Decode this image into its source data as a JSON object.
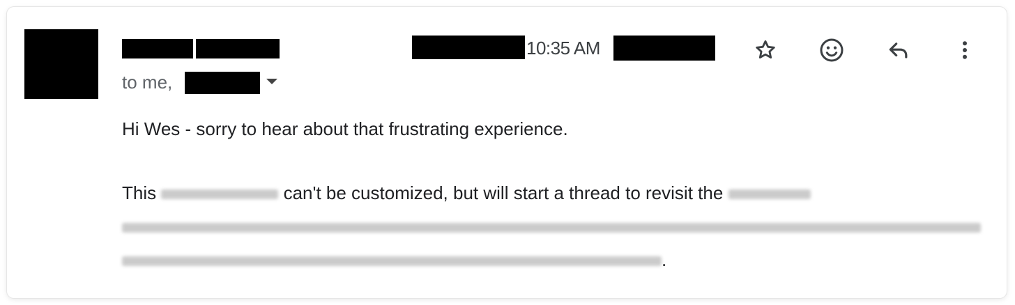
{
  "email": {
    "time": "10:35 AM",
    "recipients_prefix": "to me,",
    "greeting": "Hi Wes - sorry to hear about that frustrating experience.",
    "para2_this": "This",
    "para2_mid": " can't be customized, but will start a thread to revisit the",
    "para2_end": "."
  },
  "actions": {
    "star": "star-icon",
    "emoji": "add-reaction-icon",
    "reply": "reply-icon",
    "more": "more-vert-icon"
  },
  "colors": {
    "redaction": "#000000",
    "blurred_text": "#c9c9c9",
    "icon": "#3c4043"
  }
}
